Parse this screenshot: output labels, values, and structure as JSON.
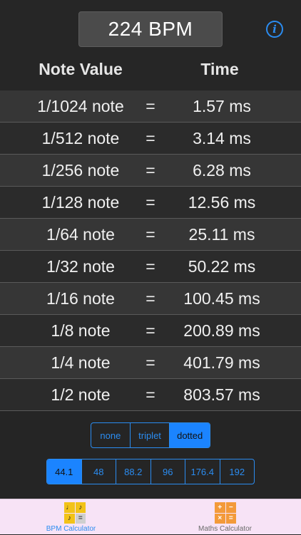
{
  "header": {
    "bpm_display": "224 BPM",
    "info_icon": "info-icon",
    "col_note": "Note Value",
    "col_time": "Time"
  },
  "rows": [
    {
      "note": "1/1024 note",
      "eq": "=",
      "time": "1.57 ms"
    },
    {
      "note": "1/512 note",
      "eq": "=",
      "time": "3.14 ms"
    },
    {
      "note": "1/256 note",
      "eq": "=",
      "time": "6.28 ms"
    },
    {
      "note": "1/128 note",
      "eq": "=",
      "time": "12.56 ms"
    },
    {
      "note": "1/64 note",
      "eq": "=",
      "time": "25.11 ms"
    },
    {
      "note": "1/32 note",
      "eq": "=",
      "time": "50.22 ms"
    },
    {
      "note": "1/16 note",
      "eq": "=",
      "time": "100.45 ms"
    },
    {
      "note": "1/8 note",
      "eq": "=",
      "time": "200.89 ms"
    },
    {
      "note": "1/4 note",
      "eq": "=",
      "time": "401.79 ms"
    },
    {
      "note": "1/2 note",
      "eq": "=",
      "time": "803.57 ms"
    }
  ],
  "modifier": {
    "options": [
      "none",
      "triplet",
      "dotted"
    ],
    "selected": "dotted"
  },
  "sample_rate": {
    "options": [
      "44.1",
      "48",
      "88.2",
      "96",
      "176.4",
      "192"
    ],
    "selected": "44.1"
  },
  "tabs": [
    {
      "label": "BPM Calculator",
      "icon": "bpm-calculator-icon",
      "active": true
    },
    {
      "label": "Maths Calculator",
      "icon": "maths-calculator-icon",
      "active": false
    }
  ],
  "colors": {
    "accent": "#2b8cf0",
    "selected_fill": "#1b84ff",
    "tabbar_bg": "#f7e3f6",
    "background": "#252525"
  }
}
